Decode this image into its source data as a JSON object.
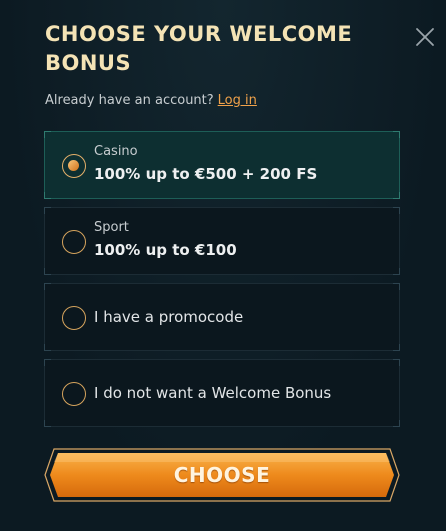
{
  "modal": {
    "title": "CHOOSE YOUR WELCOME BONUS",
    "subtitle": "Already have an account?",
    "login_link": "Log in"
  },
  "options": [
    {
      "label": "Casino",
      "desc": "100% up to €500 + 200 FS",
      "selected": true
    },
    {
      "label": "Sport",
      "desc": "100% up to €100",
      "selected": false
    },
    {
      "label": "I have a promocode",
      "selected": false
    },
    {
      "label": "I do not want a Welcome Bonus",
      "selected": false
    }
  ],
  "choose_button": {
    "label": "CHOOSE"
  },
  "colors": {
    "accent": "#f0a24a",
    "title": "#f4e3b5",
    "selected_bg": "#0d2f31",
    "button_orange": "#e8861a"
  },
  "icons": {
    "close": "close-icon"
  }
}
